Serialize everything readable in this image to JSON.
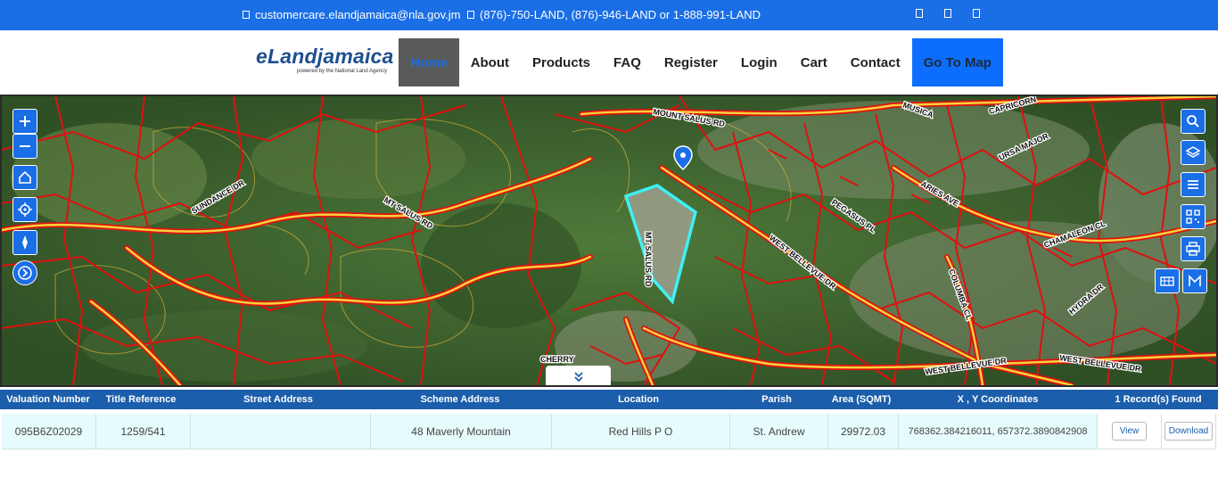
{
  "topbar": {
    "email": "customercare.elandjamaica@nla.gov.jm",
    "phone": "(876)-750-LAND, (876)-946-LAND or 1-888-991-LAND",
    "social_icons": [
      "facebook-icon",
      "twitter-icon",
      "youtube-icon"
    ]
  },
  "logo": {
    "name": "eLandjamaica",
    "tagline": "powered by the National Land Agency"
  },
  "nav": {
    "items": [
      "Home",
      "About",
      "Products",
      "FAQ",
      "Register",
      "Login",
      "Cart",
      "Contact"
    ],
    "cta": "Go To Map"
  },
  "map": {
    "roads": [
      "MOUNT SALUS RD",
      "MT SALUS RD",
      "MT SALUS RD",
      "SUNDANCE DR",
      "WEST BELLEVUE DR",
      "PEGASUS PL",
      "ARIES AVE",
      "URSA MAJOR",
      "CAPRICORN",
      "CHAMALEON CL",
      "HYDRA DR",
      "COLUMBA CL",
      "WEST BELLEVUE DR",
      "WEST BELLEVUE DR",
      "CHERRY",
      "MUSICA"
    ],
    "left_controls": [
      "zoom-in-icon",
      "zoom-out-icon",
      "home-icon",
      "locate-icon",
      "compass-icon",
      "next-icon"
    ],
    "right_controls": [
      "search-icon",
      "layers-icon",
      "list-icon",
      "qr-icon",
      "print-icon",
      "measure-icon",
      "basemap-icon"
    ],
    "colors": {
      "parcel": "#e01010",
      "road": "#f4d23a",
      "selected": "#3ff0f5",
      "marker": "#1a6ee6"
    }
  },
  "table": {
    "headers": [
      "Valuation Number",
      "Title Reference",
      "Street Address",
      "Scheme Address",
      "Location",
      "Parish",
      "Area (SQMT)",
      "X , Y Coordinates"
    ],
    "records_found": "1 Record(s) Found",
    "rows": [
      {
        "valuation_number": "095B6Z02029",
        "title_reference": "1259/541",
        "street_address": "",
        "scheme_address": "48 Maverly Mountain",
        "location": "Red Hills P O",
        "parish": "St. Andrew",
        "area": "29972.03",
        "coordinates": "768362.384216011, 657372.3890842908",
        "view_label": "View",
        "download_label": "Download"
      }
    ]
  }
}
